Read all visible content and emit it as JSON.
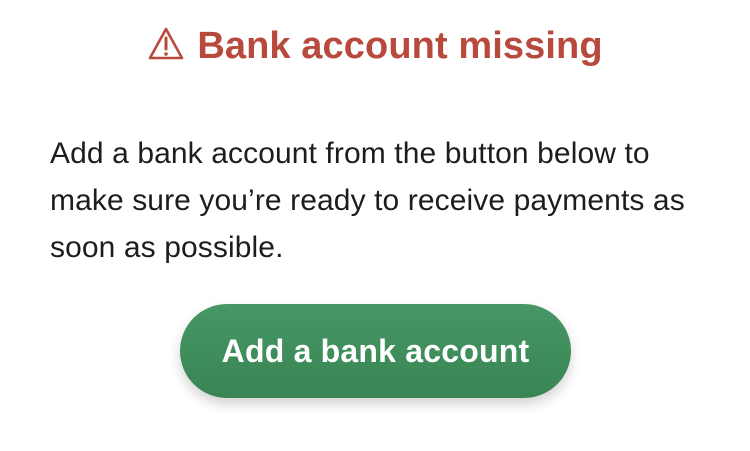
{
  "alert": {
    "icon": "warning-triangle-icon",
    "title": "Bank account missing",
    "message": "Add a bank account from the button below to make sure you’re ready to receive payments as soon as possible."
  },
  "action": {
    "add_bank_account_label": "Add a bank account"
  },
  "colors": {
    "warning": "#b84a3d",
    "primary_button": "#3f8d5b",
    "text": "#1d1d1d",
    "background": "#ffffff"
  }
}
